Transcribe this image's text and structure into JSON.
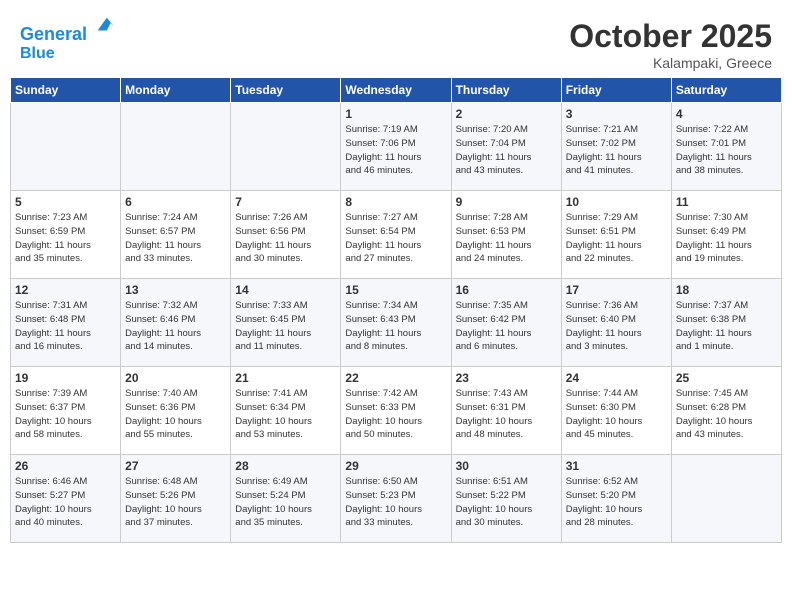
{
  "header": {
    "logo_line1": "General",
    "logo_line2": "Blue",
    "month": "October 2025",
    "location": "Kalampaki, Greece"
  },
  "weekdays": [
    "Sunday",
    "Monday",
    "Tuesday",
    "Wednesday",
    "Thursday",
    "Friday",
    "Saturday"
  ],
  "weeks": [
    [
      {
        "day": "",
        "info": ""
      },
      {
        "day": "",
        "info": ""
      },
      {
        "day": "",
        "info": ""
      },
      {
        "day": "1",
        "info": "Sunrise: 7:19 AM\nSunset: 7:06 PM\nDaylight: 11 hours\nand 46 minutes."
      },
      {
        "day": "2",
        "info": "Sunrise: 7:20 AM\nSunset: 7:04 PM\nDaylight: 11 hours\nand 43 minutes."
      },
      {
        "day": "3",
        "info": "Sunrise: 7:21 AM\nSunset: 7:02 PM\nDaylight: 11 hours\nand 41 minutes."
      },
      {
        "day": "4",
        "info": "Sunrise: 7:22 AM\nSunset: 7:01 PM\nDaylight: 11 hours\nand 38 minutes."
      }
    ],
    [
      {
        "day": "5",
        "info": "Sunrise: 7:23 AM\nSunset: 6:59 PM\nDaylight: 11 hours\nand 35 minutes."
      },
      {
        "day": "6",
        "info": "Sunrise: 7:24 AM\nSunset: 6:57 PM\nDaylight: 11 hours\nand 33 minutes."
      },
      {
        "day": "7",
        "info": "Sunrise: 7:26 AM\nSunset: 6:56 PM\nDaylight: 11 hours\nand 30 minutes."
      },
      {
        "day": "8",
        "info": "Sunrise: 7:27 AM\nSunset: 6:54 PM\nDaylight: 11 hours\nand 27 minutes."
      },
      {
        "day": "9",
        "info": "Sunrise: 7:28 AM\nSunset: 6:53 PM\nDaylight: 11 hours\nand 24 minutes."
      },
      {
        "day": "10",
        "info": "Sunrise: 7:29 AM\nSunset: 6:51 PM\nDaylight: 11 hours\nand 22 minutes."
      },
      {
        "day": "11",
        "info": "Sunrise: 7:30 AM\nSunset: 6:49 PM\nDaylight: 11 hours\nand 19 minutes."
      }
    ],
    [
      {
        "day": "12",
        "info": "Sunrise: 7:31 AM\nSunset: 6:48 PM\nDaylight: 11 hours\nand 16 minutes."
      },
      {
        "day": "13",
        "info": "Sunrise: 7:32 AM\nSunset: 6:46 PM\nDaylight: 11 hours\nand 14 minutes."
      },
      {
        "day": "14",
        "info": "Sunrise: 7:33 AM\nSunset: 6:45 PM\nDaylight: 11 hours\nand 11 minutes."
      },
      {
        "day": "15",
        "info": "Sunrise: 7:34 AM\nSunset: 6:43 PM\nDaylight: 11 hours\nand 8 minutes."
      },
      {
        "day": "16",
        "info": "Sunrise: 7:35 AM\nSunset: 6:42 PM\nDaylight: 11 hours\nand 6 minutes."
      },
      {
        "day": "17",
        "info": "Sunrise: 7:36 AM\nSunset: 6:40 PM\nDaylight: 11 hours\nand 3 minutes."
      },
      {
        "day": "18",
        "info": "Sunrise: 7:37 AM\nSunset: 6:38 PM\nDaylight: 11 hours\nand 1 minute."
      }
    ],
    [
      {
        "day": "19",
        "info": "Sunrise: 7:39 AM\nSunset: 6:37 PM\nDaylight: 10 hours\nand 58 minutes."
      },
      {
        "day": "20",
        "info": "Sunrise: 7:40 AM\nSunset: 6:36 PM\nDaylight: 10 hours\nand 55 minutes."
      },
      {
        "day": "21",
        "info": "Sunrise: 7:41 AM\nSunset: 6:34 PM\nDaylight: 10 hours\nand 53 minutes."
      },
      {
        "day": "22",
        "info": "Sunrise: 7:42 AM\nSunset: 6:33 PM\nDaylight: 10 hours\nand 50 minutes."
      },
      {
        "day": "23",
        "info": "Sunrise: 7:43 AM\nSunset: 6:31 PM\nDaylight: 10 hours\nand 48 minutes."
      },
      {
        "day": "24",
        "info": "Sunrise: 7:44 AM\nSunset: 6:30 PM\nDaylight: 10 hours\nand 45 minutes."
      },
      {
        "day": "25",
        "info": "Sunrise: 7:45 AM\nSunset: 6:28 PM\nDaylight: 10 hours\nand 43 minutes."
      }
    ],
    [
      {
        "day": "26",
        "info": "Sunrise: 6:46 AM\nSunset: 5:27 PM\nDaylight: 10 hours\nand 40 minutes."
      },
      {
        "day": "27",
        "info": "Sunrise: 6:48 AM\nSunset: 5:26 PM\nDaylight: 10 hours\nand 37 minutes."
      },
      {
        "day": "28",
        "info": "Sunrise: 6:49 AM\nSunset: 5:24 PM\nDaylight: 10 hours\nand 35 minutes."
      },
      {
        "day": "29",
        "info": "Sunrise: 6:50 AM\nSunset: 5:23 PM\nDaylight: 10 hours\nand 33 minutes."
      },
      {
        "day": "30",
        "info": "Sunrise: 6:51 AM\nSunset: 5:22 PM\nDaylight: 10 hours\nand 30 minutes."
      },
      {
        "day": "31",
        "info": "Sunrise: 6:52 AM\nSunset: 5:20 PM\nDaylight: 10 hours\nand 28 minutes."
      },
      {
        "day": "",
        "info": ""
      }
    ]
  ]
}
